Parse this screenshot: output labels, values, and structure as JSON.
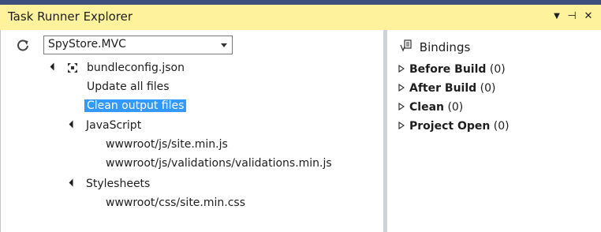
{
  "window": {
    "title": "Task Runner Explorer",
    "menu_glyph": "▼",
    "pin_glyph": "⊣",
    "close_glyph": "✕"
  },
  "toolbar": {
    "refresh_icon": "refresh-icon",
    "project_value": "SpyStore.MVC"
  },
  "tree": {
    "root": "bundleconfig.json",
    "tasks": [
      "Update all files",
      "Clean output files"
    ],
    "groups": [
      {
        "label": "JavaScript",
        "files": [
          "wwwroot/js/site.min.js",
          "wwwroot/js/validations/validations.min.js"
        ]
      },
      {
        "label": "Stylesheets",
        "files": [
          "wwwroot/css/site.min.css"
        ]
      }
    ],
    "selected_task": "Clean output files"
  },
  "bindings": {
    "tab_label": "Bindings",
    "items": [
      {
        "name": "Before Build",
        "count": "(0)"
      },
      {
        "name": "After Build",
        "count": "(0)"
      },
      {
        "name": "Clean",
        "count": "(0)"
      },
      {
        "name": "Project Open",
        "count": "(0)"
      }
    ]
  },
  "colors": {
    "titlebar_bg": "#fff29d",
    "selection": "#3399ff"
  }
}
